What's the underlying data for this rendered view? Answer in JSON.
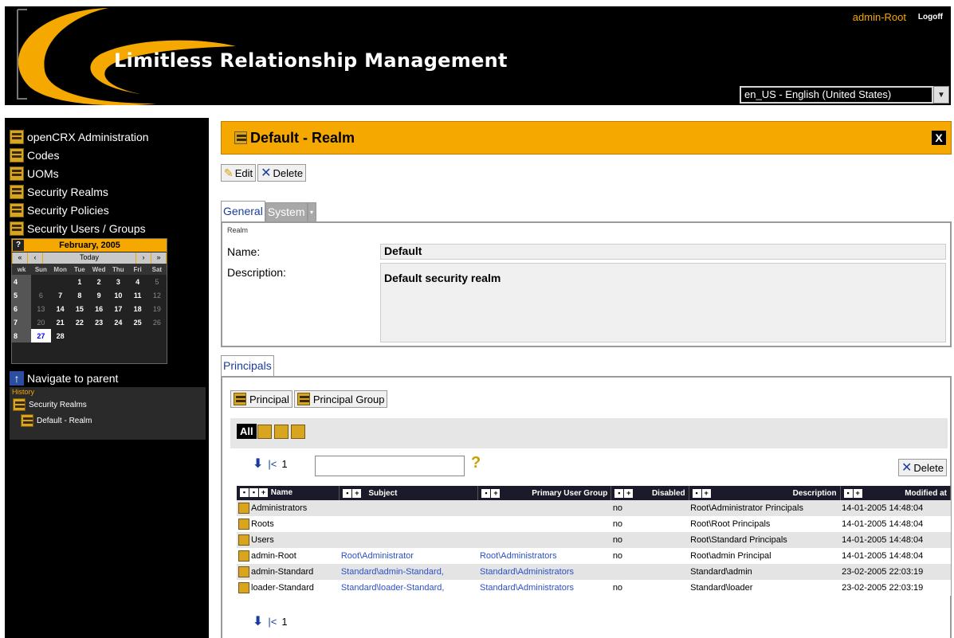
{
  "header": {
    "app_title": "Limitless Relationship Management",
    "user": "admin-Root",
    "logoff": "Logoff",
    "language": "en_US - English (United States)"
  },
  "sidebar": {
    "items": [
      {
        "label": "openCRX Administration",
        "icon": "admin-icon"
      },
      {
        "label": "Codes",
        "icon": "codes-icon"
      },
      {
        "label": "UOMs",
        "icon": "uoms-icon"
      },
      {
        "label": "Security Realms",
        "icon": "realm-icon"
      },
      {
        "label": "Security Policies",
        "icon": "policy-icon"
      },
      {
        "label": "Security Users / Groups",
        "icon": "users-icon"
      }
    ],
    "calendar": {
      "help": "?",
      "title": "February, 2005",
      "nav_prev2": "«",
      "nav_prev": "‹",
      "nav_today": "Today",
      "nav_next": "›",
      "nav_next2": "»",
      "dow": [
        "wk",
        "Sun",
        "Mon",
        "Tue",
        "Wed",
        "Thu",
        "Fri",
        "Sat"
      ],
      "weeks": [
        [
          "4",
          "",
          "",
          "1",
          "2",
          "3",
          "4",
          "5"
        ],
        [
          "5",
          "6",
          "7",
          "8",
          "9",
          "10",
          "11",
          "12"
        ],
        [
          "6",
          "13",
          "14",
          "15",
          "16",
          "17",
          "18",
          "19"
        ],
        [
          "7",
          "20",
          "21",
          "22",
          "23",
          "24",
          "25",
          "26"
        ],
        [
          "8",
          "27",
          "28",
          "",
          "",
          "",
          "",
          ""
        ]
      ]
    },
    "navigate_parent": "Navigate to parent",
    "history_label": "History",
    "history": [
      "Security Realms",
      "Default - Realm"
    ]
  },
  "page": {
    "title": "Default - Realm",
    "close": "X",
    "toolbar": {
      "edit": "Edit",
      "delete": "Delete"
    },
    "tabs": {
      "general": "General",
      "system": "System",
      "more": "▾"
    },
    "general": {
      "section": "Realm",
      "name_label": "Name:",
      "name_value": "Default",
      "description_label": "Description:",
      "description_value": "Default security realm"
    },
    "principals_tab": "Principals",
    "principals_toolbar": {
      "principal": "Principal",
      "principal_group": "Principal Group"
    },
    "filter_all": "All",
    "pager": {
      "page": "1",
      "first": "|<"
    },
    "search_placeholder": "",
    "help": "?",
    "list_delete": "Delete"
  },
  "table": {
    "columns": [
      "Name",
      "Subject",
      "Primary User Group",
      "Disabled",
      "Description",
      "Modified at"
    ],
    "rows": [
      {
        "name": "Administrators",
        "subject": "",
        "group": "",
        "disabled": "no",
        "description": "Root\\Administrator Principals",
        "modified": "14-01-2005 14:48:04"
      },
      {
        "name": "Roots",
        "subject": "",
        "group": "",
        "disabled": "no",
        "description": "Root\\Root Principals",
        "modified": "14-01-2005 14:48:04"
      },
      {
        "name": "Users",
        "subject": "",
        "group": "",
        "disabled": "no",
        "description": "Root\\Standard Principals",
        "modified": "14-01-2005 14:48:04"
      },
      {
        "name": "admin-Root",
        "subject": "Root\\Administrator",
        "group": "Root\\Administrators",
        "disabled": "no",
        "description": "Root\\admin Principal",
        "modified": "14-01-2005 14:48:04"
      },
      {
        "name": "admin-Standard",
        "subject": "Standard\\admin-Standard,",
        "group": "Standard\\Administrators",
        "disabled": "",
        "description": "Standard\\admin",
        "modified": "23-02-2005 22:03:19"
      },
      {
        "name": "loader-Standard",
        "subject": "Standard\\loader-Standard,",
        "group": "Standard\\Administrators",
        "disabled": "no",
        "description": "Standard\\loader",
        "modified": "23-02-2005 22:03:19"
      }
    ]
  },
  "colors": {
    "accent": "#f5a800",
    "link": "#2a50c8",
    "header_bg": "#000000"
  }
}
